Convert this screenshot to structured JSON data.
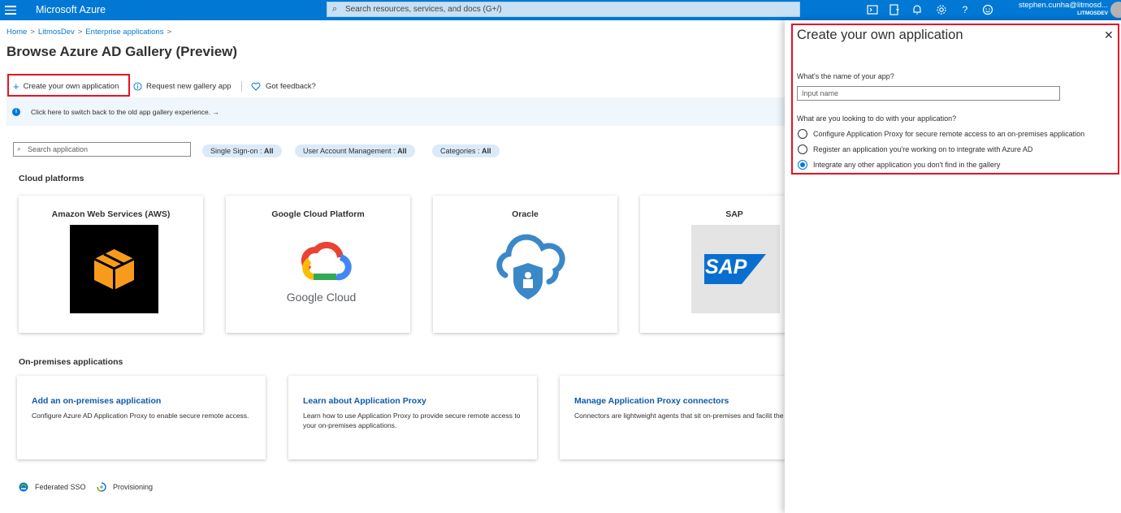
{
  "topbar": {
    "brand": "Microsoft Azure",
    "search_placeholder": "Search resources, services, and docs (G+/)",
    "icons": [
      "cloud-shell-icon",
      "directory-filter-icon",
      "notifications-icon",
      "settings-icon",
      "help-icon",
      "feedback-icon"
    ],
    "user_email": "stephen.cunha@litmosd...",
    "user_tenant": "LITMOSDEV"
  },
  "breadcrumb": [
    "Home",
    "LitmosDev",
    "Enterprise applications"
  ],
  "page": {
    "title": "Browse Azure AD Gallery (Preview)"
  },
  "commands": {
    "create": "Create your own application",
    "request": "Request new gallery app",
    "feedback": "Got feedback?"
  },
  "banner": {
    "text": "Click here to switch back to the old app gallery experience. →"
  },
  "filters": {
    "search_placeholder": "Search application",
    "sso_label": "Single Sign-on : ",
    "sso_value": "All",
    "uam_label": "User Account Management : ",
    "uam_value": "All",
    "cat_label": "Categories : ",
    "cat_value": "All"
  },
  "cloud": {
    "title": "Cloud platforms",
    "cards": [
      {
        "name": "Amazon Web Services (AWS)"
      },
      {
        "name": "Google Cloud Platform",
        "logo_text": "Google Cloud"
      },
      {
        "name": "Oracle"
      },
      {
        "name": "SAP",
        "logo_text": "SAP"
      }
    ]
  },
  "onprem": {
    "title": "On-premises applications",
    "cards": [
      {
        "link": "Add an on-premises application",
        "desc": "Configure Azure AD Application Proxy to enable secure remote access."
      },
      {
        "link": "Learn about Application Proxy",
        "desc": "Learn how to use Application Proxy to provide secure remote access to your on-premises applications."
      },
      {
        "link": "Manage Application Proxy connectors",
        "desc": "Connectors are lightweight agents that sit on-premises and facilit the outbound connection to the Application Proxy service."
      }
    ]
  },
  "legend": {
    "federated": "Federated SSO",
    "provisioning": "Provisioning"
  },
  "panel": {
    "title": "Create your own application",
    "name_label": "What's the name of your app?",
    "name_placeholder": "Input name",
    "purpose_label": "What are you looking to do with your application?",
    "options": [
      {
        "label": "Configure Application Proxy for secure remote access to an on-premises application",
        "selected": false
      },
      {
        "label": "Register an application you're working on to integrate with Azure AD",
        "selected": false
      },
      {
        "label": "Integrate any other application you don't find in the gallery",
        "selected": true
      }
    ]
  },
  "colors": {
    "azure_blue": "#0078d4",
    "highlight_red": "#e81123",
    "link_blue": "#0f5bab"
  }
}
